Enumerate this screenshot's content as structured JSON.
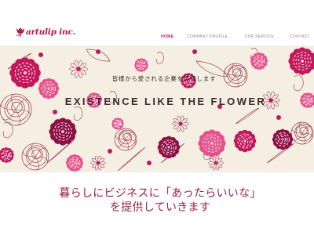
{
  "logo": {
    "text": "artulip inc."
  },
  "nav": {
    "items": [
      {
        "label": "HOME",
        "active": true,
        "dropdown": false
      },
      {
        "label": "COMPANY PROFILE",
        "active": false,
        "dropdown": true
      },
      {
        "label": "OUR SERVICE",
        "active": false,
        "dropdown": true
      },
      {
        "label": "CONTACT",
        "active": false,
        "dropdown": false
      }
    ],
    "caret": "⌄"
  },
  "hero": {
    "tagline": "皆様から愛される企業を目指します",
    "headline": "EXISTENCE LIKE THE FLOWER"
  },
  "lead": {
    "line1": "暮らしにビジネスに「あったらいいな」",
    "line2": "を提供していきます"
  },
  "colors": {
    "brand": "#b0164f",
    "nav_active": "#c2185b",
    "hero_bg": "#f4efe2",
    "flower_magenta": "#c2185b",
    "flower_pink": "#e8508a",
    "flower_dark": "#8e1045",
    "outline": "#a34a5e",
    "lead_text": "#9a2244"
  }
}
